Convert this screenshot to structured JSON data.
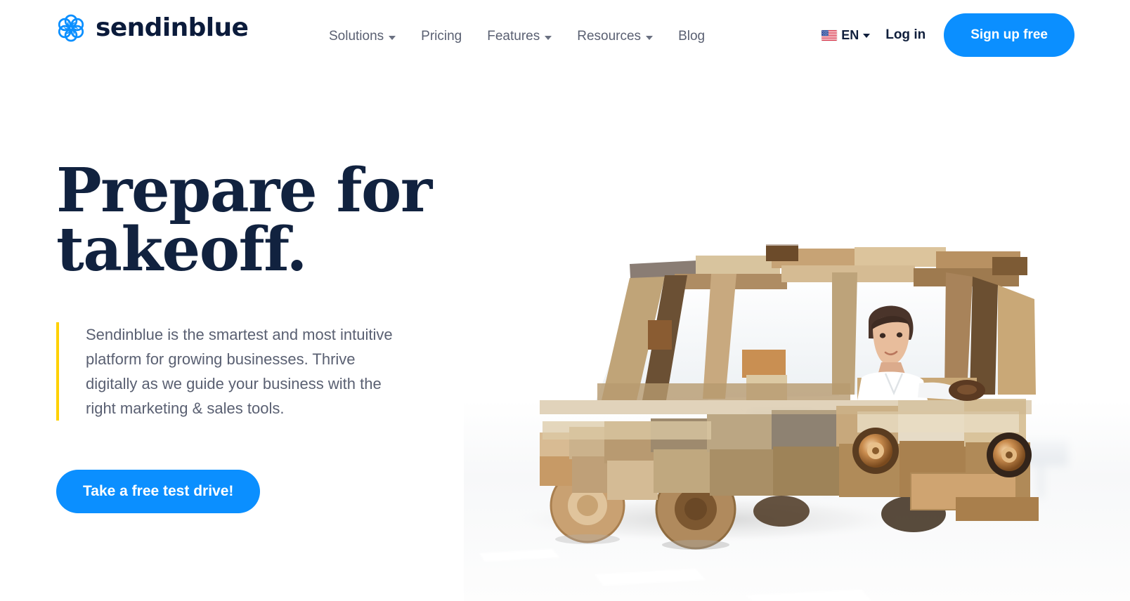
{
  "header": {
    "brand": {
      "name": "sendinblue",
      "logo_icon": "sendinblue-pinwheel-icon",
      "logo_color": "#0B8FFF",
      "wordmark_color": "#0B1B3B"
    },
    "nav": [
      {
        "label": "Solutions",
        "has_dropdown": true
      },
      {
        "label": "Pricing",
        "has_dropdown": false
      },
      {
        "label": "Features",
        "has_dropdown": true
      },
      {
        "label": "Resources",
        "has_dropdown": true
      },
      {
        "label": "Blog",
        "has_dropdown": false
      }
    ],
    "language": {
      "code": "EN",
      "flag_icon": "flag-us-icon",
      "has_dropdown": true
    },
    "login_label": "Log in",
    "signup_label": "Sign up free",
    "signup_color": "#0B8FFF"
  },
  "hero": {
    "headline_line1": "Prepare for",
    "headline_line2": "takeoff.",
    "headline_color": "#11223F",
    "lede": "Sendinblue is the smartest and most intuitive platform for growing businesses. Thrive digitally as we guide your business with the right marketing & sales tools.",
    "lede_accent_color": "#FFD100",
    "cta_label": "Take a free test drive!",
    "cta_color": "#0B8FFF",
    "image_alt": "Wooden toy car built from blocks driven by a person on a white road with blurred road signs"
  }
}
